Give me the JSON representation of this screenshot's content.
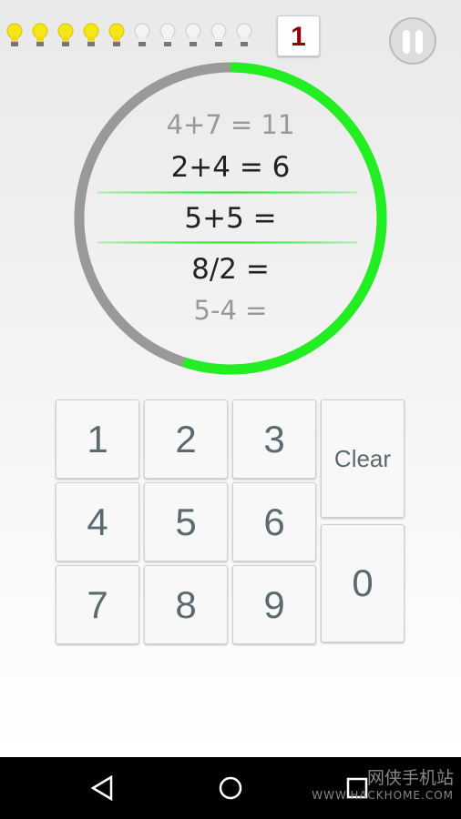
{
  "hud": {
    "bulbs": [
      true,
      true,
      true,
      true,
      true,
      false,
      false,
      false,
      false,
      false
    ],
    "level": "1",
    "pause_icon": "pause-icon"
  },
  "timer": {
    "progress_fraction": 0.55,
    "colors": {
      "elapsed": "#22ee22",
      "remaining": "#999999"
    }
  },
  "equations": {
    "previous_2": "4+7 = 11",
    "previous_1": "2+4 = 6",
    "current": "5+5 =",
    "next_1": "8/2 =",
    "next_2": "5-4 ="
  },
  "keypad": {
    "keys": [
      "1",
      "2",
      "3",
      "4",
      "5",
      "6",
      "7",
      "8",
      "9"
    ],
    "clear": "Clear",
    "zero": "0"
  },
  "watermark": {
    "text": "网侠手机站",
    "url": "WWW.HACKHOME.COM"
  }
}
